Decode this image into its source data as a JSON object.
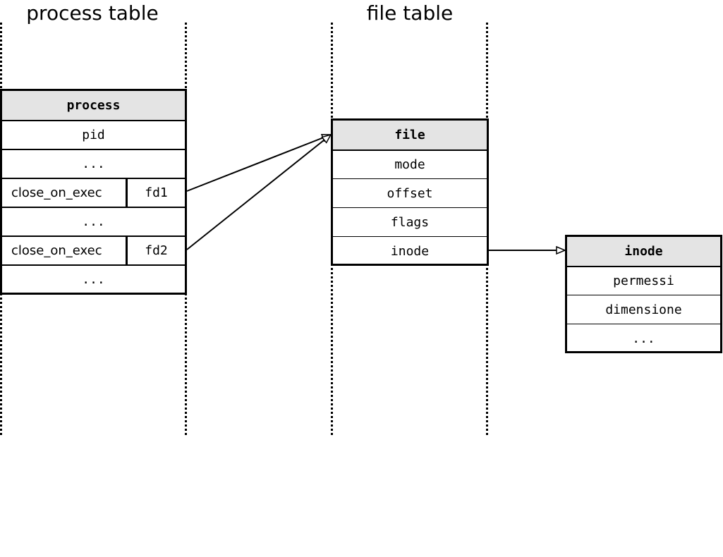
{
  "columns": {
    "process_table": "process table",
    "file_table": "file table"
  },
  "process": {
    "header": "process",
    "rows": [
      {
        "label": "pid"
      },
      {
        "label": "..."
      },
      {
        "flag": "close_on_exec",
        "fd": "fd1"
      },
      {
        "label": "..."
      },
      {
        "flag": "close_on_exec",
        "fd": "fd2"
      },
      {
        "label": "..."
      }
    ]
  },
  "file": {
    "header": "file",
    "rows": [
      "mode",
      "offset",
      "flags",
      "inode"
    ]
  },
  "inode": {
    "header": "inode",
    "rows": [
      "permessi",
      "dimensione",
      "..."
    ]
  },
  "links": [
    {
      "from": "process.fd1",
      "to": "file"
    },
    {
      "from": "process.fd2",
      "to": "file"
    },
    {
      "from": "file.inode",
      "to": "inode"
    }
  ]
}
